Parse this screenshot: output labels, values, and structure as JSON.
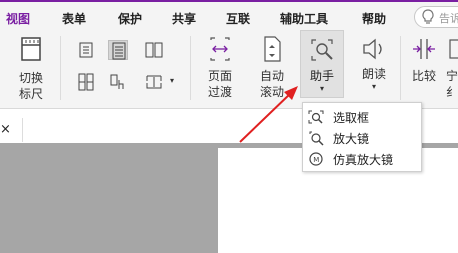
{
  "menu": {
    "tabs": [
      {
        "label": "视图"
      },
      {
        "label": "表单"
      },
      {
        "label": "保护"
      },
      {
        "label": "共享"
      },
      {
        "label": "互联"
      },
      {
        "label": "辅助工具"
      },
      {
        "label": "帮助"
      }
    ],
    "tellme_text": "告诉"
  },
  "ribbon": {
    "toggle_ruler": "切换\n标尺",
    "page_transition": "页面\n过渡",
    "auto_scroll": "自动\n滚动",
    "assistant": "助手",
    "read_aloud": "朗读",
    "compare": "比较",
    "truncated_next": "宁\n纟"
  },
  "dropdown": {
    "items": [
      {
        "label": "选取框"
      },
      {
        "label": "放大镜"
      },
      {
        "label": "仿真放大镜"
      }
    ]
  },
  "document_tab": {
    "close": "×"
  },
  "colors": {
    "accent": "#7a1fa2",
    "arrow": "#e02020",
    "canvas": "#a6a6a6"
  }
}
